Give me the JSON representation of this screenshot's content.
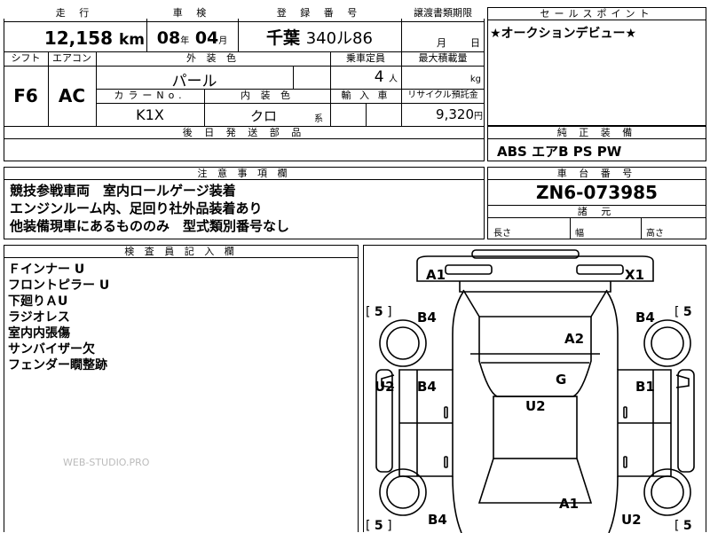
{
  "top": {
    "hdr_mileage": "走 行",
    "hdr_inspection": "車 検",
    "hdr_registration": "登 録 番 号",
    "hdr_transfer_date": "譲渡書類期限",
    "mileage": "12,158",
    "mileage_unit": "km",
    "inspection_year": "08",
    "year_unit": "年",
    "inspection_month": "04",
    "month_unit": "月",
    "registration_area": "千葉",
    "registration_number": "340ル86",
    "transfer_month_unit": "月",
    "transfer_day_unit": "日"
  },
  "row2": {
    "hdr_shift": "シフト",
    "hdr_aircon": "エアコン",
    "hdr_exterior": "外 装 色",
    "hdr_capacity": "乗車定員",
    "hdr_max_load": "最大積載量",
    "shift": "F6",
    "aircon": "AC",
    "exterior_color": "パール",
    "capacity": "4",
    "capacity_unit": "人",
    "load_unit": "kg",
    "hdr_color_no": "カラーNo.",
    "hdr_interior": "内 装 色",
    "hdr_import": "輸 入 車",
    "hdr_recycle": "リサイクル預託金",
    "color_no": "K1X",
    "interior": "クロ",
    "interior_suffix": "系",
    "recycle_fee": "9,320",
    "recycle_unit": "円",
    "hdr_later_parts": "後 日 発 送 部 品"
  },
  "sales": {
    "hdr": "セールスポイント",
    "text": "★オークションデビュー★"
  },
  "equipment": {
    "hdr": "純 正 装 備",
    "text": "ABS エアB PS PW"
  },
  "notes": {
    "hdr": "注 意 事 項 欄",
    "lines": [
      "競技参戦車両　室内ロールゲージ装着",
      "エンジンルーム内、足回り社外品装着あり",
      "他装備現車にあるもののみ　型式類別番号なし"
    ]
  },
  "chassis": {
    "hdr": "車 台 番 号",
    "number": "ZN6-073985",
    "dims_hdr": "諸 元",
    "length": "長さ",
    "width": "幅",
    "height": "高さ"
  },
  "inspector": {
    "hdr": "検 査 員 記 入 欄",
    "lines": [
      "Ｆインナー U",
      "フロントピラー U",
      "下廻りＡU",
      "ラジオレス",
      "室内内張傷",
      "サンバイザー欠",
      "フェンダー瞯整跡"
    ],
    "watermark": "WEB-STUDIO.PRO"
  },
  "diagram": {
    "marks": {
      "a1_top": "A1",
      "x1": "X1",
      "tire_fl": "5",
      "tire_fr": "5",
      "tire_rl": "5",
      "tire_rr": "5",
      "b4_fl": "B4",
      "b4_fr": "B4",
      "a2": "A2",
      "u2_left": "U2",
      "b4_mid": "B4",
      "g": "G",
      "b1": "B1",
      "u2_center": "U2",
      "a1_bottom": "A1",
      "b4_bottom": "B4",
      "u2_bottom": "U2"
    }
  }
}
